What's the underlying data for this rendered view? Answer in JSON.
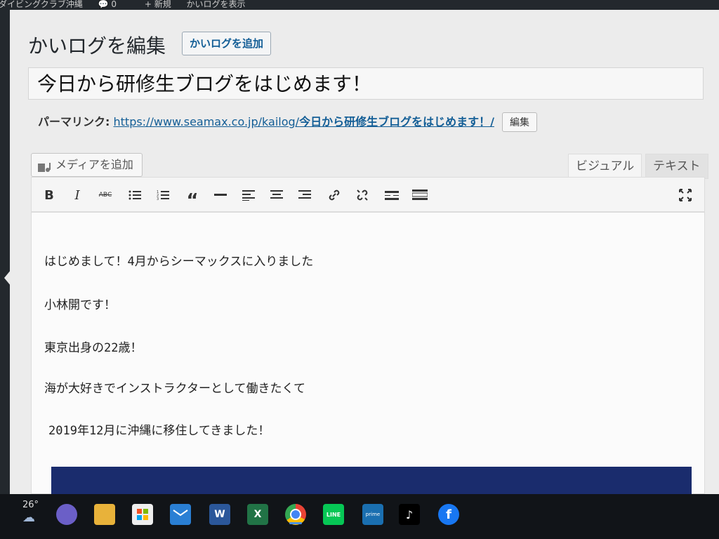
{
  "admin_bar": {
    "site_name": "ダイビングクラブ沖縄",
    "comments_count": "0",
    "new_label": "+ 新規",
    "view_label": "かいログを表示"
  },
  "page": {
    "title": "かいログを編集",
    "add_new_label": "かいログを追加"
  },
  "post": {
    "title": "今日から研修生ブログをはじめます！",
    "permalink_label": "パーマリンク:",
    "permalink_base": "https://www.seamax.co.jp/kailog/",
    "permalink_slug": "今日から研修生ブログをはじめます！/",
    "permalink_edit": "編集"
  },
  "editor": {
    "add_media_label": "メディアを追加",
    "tab_visual": "ビジュアル",
    "tab_text": "テキスト",
    "toolbar": [
      "bold-icon",
      "italic-icon",
      "strikethrough-icon",
      "bullet-list-icon",
      "numbered-list-icon",
      "blockquote-icon",
      "horizontal-line-icon",
      "align-left-icon",
      "align-center-icon",
      "align-right-icon",
      "link-icon",
      "unlink-icon",
      "read-more-icon",
      "toolbar-toggle-icon",
      "fullscreen-icon"
    ],
    "paragraphs": [
      "はじめまして！4月からシーマックスに入りました",
      "小林開です！",
      "東京出身の22歳！",
      "海が大好きでインストラクターとして働きたくて",
      "2019年12月に沖縄に移住してきました！"
    ]
  },
  "taskbar": {
    "weather_temp": "26°",
    "apps": [
      "weather-icon",
      "teams-icon",
      "file-explorer-icon",
      "microsoft-store-icon",
      "mail-icon",
      "word-icon",
      "excel-icon",
      "chrome-icon",
      "line-icon",
      "prime-video-icon",
      "tiktok-icon",
      "facebook-icon"
    ]
  },
  "colors": {
    "link": "#135e96",
    "taskbar": "#111418"
  }
}
